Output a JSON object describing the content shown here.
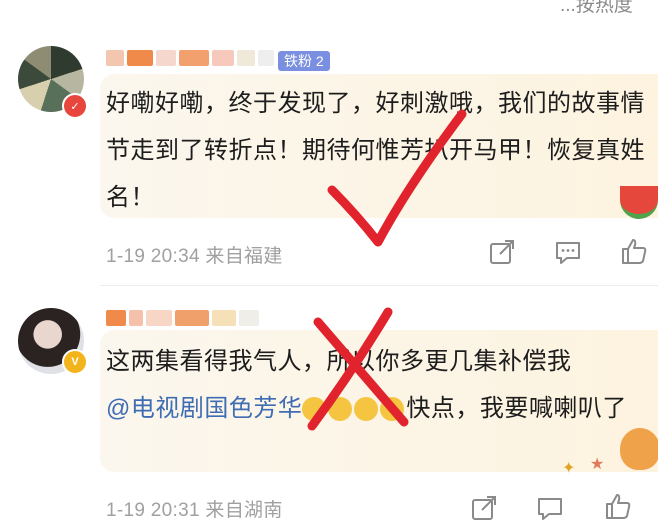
{
  "header": {
    "sort_label": "...按热度"
  },
  "comments": [
    {
      "fan_badge": "铁粉 2",
      "text": "好嘞好嘞，终于发现了，好刺激哦，我们的故事情节走到了转折点！期待何惟芳扒开马甲！恢复真姓名！",
      "meta": "1-19 20:34 来自福建",
      "icons": [
        "share-icon",
        "comment-icon",
        "like-icon"
      ],
      "overlay_mark": "check-mark",
      "accent": "#e0232c"
    },
    {
      "text_before": "这两集看得我气人，所以你多更几集补偿我",
      "mention": "@电视剧国色芳华",
      "text_after": "快点，我要喊喇叭了",
      "meta": "1-19 20:31 来自湖南",
      "icons": [
        "share-icon",
        "comment-icon",
        "like-icon"
      ],
      "overlay_mark": "cross-mark",
      "accent": "#e0232c"
    }
  ]
}
